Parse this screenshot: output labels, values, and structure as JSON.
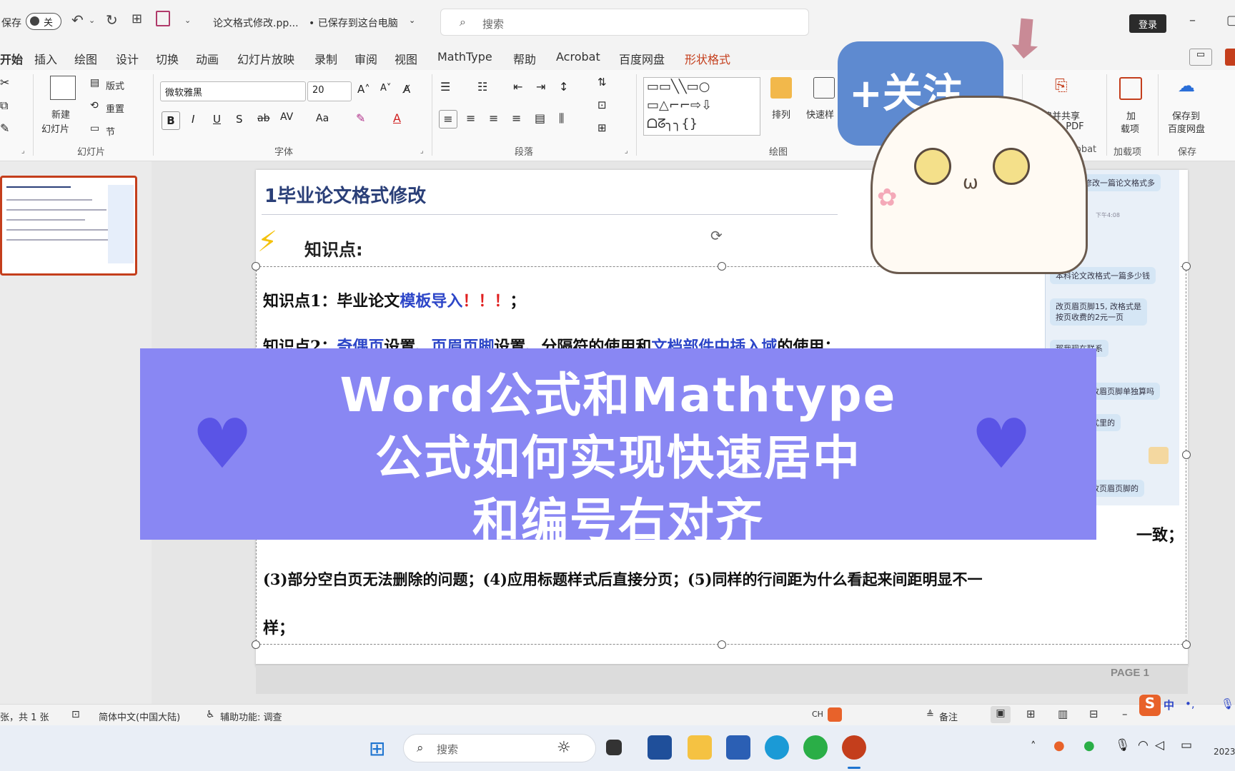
{
  "titlebar": {
    "autosave_label": "保存",
    "autosave_state": "关",
    "filename": "论文格式修改.pp...",
    "saved_status": "• 已保存到这台电脑",
    "search_placeholder": "搜索",
    "login_button": "登录"
  },
  "tabs": [
    "开始",
    "插入",
    "绘图",
    "设计",
    "切换",
    "动画",
    "幻灯片放映",
    "录制",
    "审阅",
    "视图",
    "MathType",
    "帮助",
    "Acrobat",
    "百度网盘",
    "形状格式"
  ],
  "active_tab": "开始",
  "ribbon": {
    "slides_group": {
      "new_slide_label": "新建",
      "new_slide_sub": "幻灯片",
      "layout_label": "版式",
      "reset_label": "重置",
      "section_label": "节",
      "group_label": "幻灯片"
    },
    "font_group": {
      "font_name": "微软雅黑",
      "font_size": "20",
      "group_label": "字体"
    },
    "paragraph_group": {
      "group_label": "段落"
    },
    "drawing_group": {
      "arrange_label": "排列",
      "quick_styles_label": "快速样",
      "group_label": "绘图"
    },
    "acrobat_group": {
      "create_share_label": "创建并共享",
      "adobe_pdf_label": "Adobe PDF",
      "group_label": "Acrobat"
    },
    "addins_group": {
      "addins_label": "加",
      "addins_label2": "载项",
      "group_label": "加载项"
    },
    "save_group": {
      "save_to_label": "保存到",
      "baidu_label": "百度网盘",
      "group_label": "保存"
    }
  },
  "slide": {
    "title": "1毕业论文格式修改",
    "knowledge_heading": "知识点:",
    "kp1_prefix": "知识点1：毕业论文",
    "kp1_highlight": "模板导入",
    "kp1_marks": "！！！",
    "kp1_suffix": "；",
    "kp2_prefix": "知识点2：",
    "kp2_part1": "奇偶页",
    "kp2_mid1": "设置、",
    "kp2_part2": "页眉页脚",
    "kp2_mid2": "设置、分隔符的使用和",
    "kp2_part3": "文档部件中插入域",
    "kp2_suffix": "的使用；",
    "line_consistent_tail": "一致；",
    "line3": "(3)部分空白页无法删除的问题；(4)应用标题样式后直接分页；(5)同样的行间距为什么看起来间距明显不一",
    "line3_tail": "样；",
    "page_label": "PAGE 1"
  },
  "chat_bubbles": [
    "修改一篇论文格式多",
    "下午4:08",
    "本科论文改格式一篇多少钱",
    "改页眉页脚15, 改格式是",
    "按页收费的2元一页",
    "那我现在联系",
    "改眉页脚单独算吗",
    "式里的",
    "改页眉页脚的"
  ],
  "banner": {
    "line1": "Word公式和Mathtype",
    "line2": "公式如何实现快速居中",
    "line3": "和编号右对齐"
  },
  "sticker": {
    "follow_text": "+关注"
  },
  "statusbar": {
    "slide_count": "张，共 1 张",
    "language": "简体中文(中国大陆)",
    "accessibility": "辅助功能: 调查",
    "notes_label": "备注",
    "ime_text": "CH"
  },
  "taskbar": {
    "search_placeholder": "搜索",
    "year": "2023"
  },
  "colors": {
    "accent": "#c43e1c",
    "banner_bg": "#8987f3",
    "heart": "#5a54e6",
    "slide_title": "#2a3f78",
    "link_blue": "#2d46c8"
  }
}
